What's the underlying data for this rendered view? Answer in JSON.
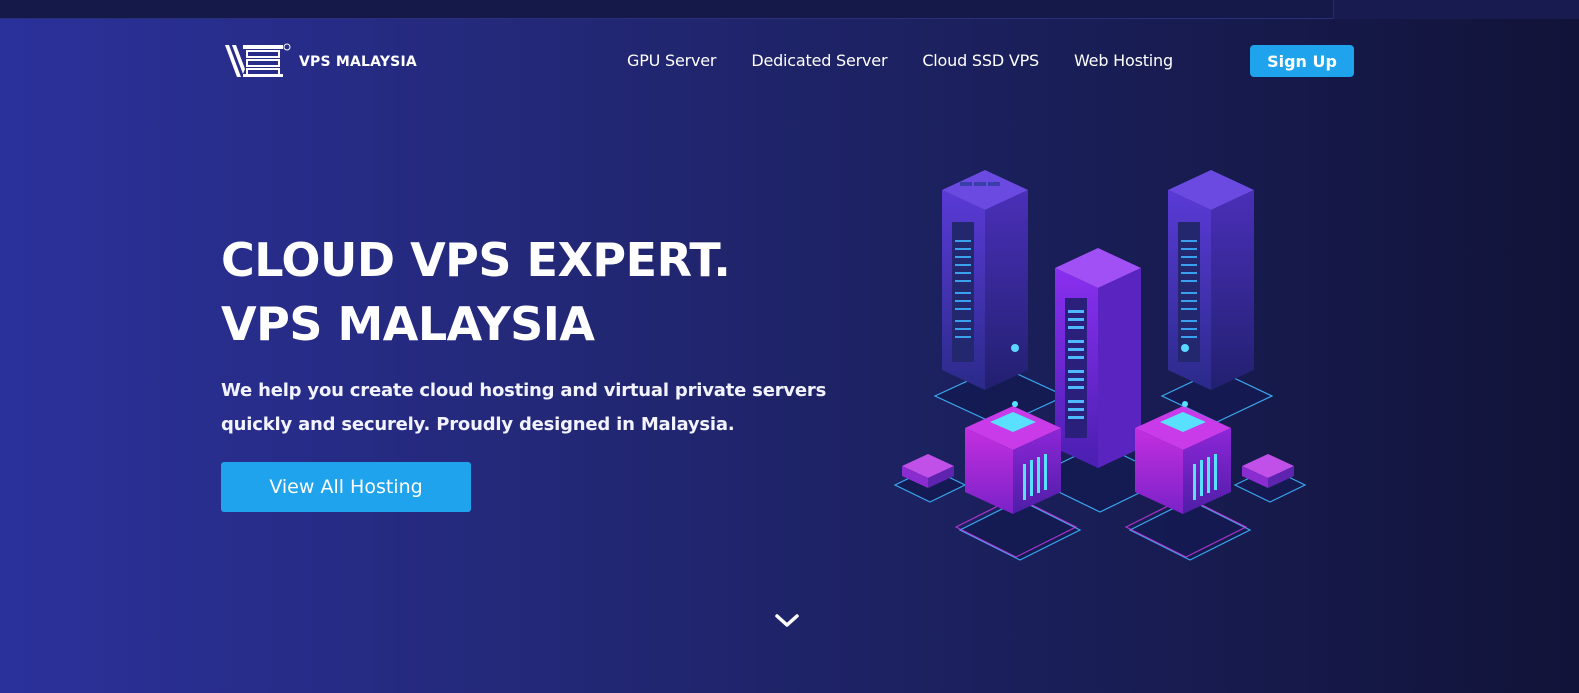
{
  "header": {
    "logo_text": "VPS MALAYSIA",
    "logo_icon": "vps-logo-mark",
    "nav": [
      {
        "label": "GPU Server"
      },
      {
        "label": "Dedicated Server"
      },
      {
        "label": "Cloud SSD VPS"
      },
      {
        "label": "Web Hosting"
      }
    ],
    "signup_label": "Sign Up"
  },
  "hero": {
    "title_line1": "CLOUD VPS EXPERT.",
    "title_line2": "VPS MALAYSIA",
    "subtitle_line1": "We help you create cloud hosting and virtual private servers",
    "subtitle_line2": "quickly and securely. Proudly designed in Malaysia.",
    "cta_label": "View All Hosting",
    "illustration": "isometric-servers-illustration",
    "scroll_icon": "chevron-down-icon"
  },
  "colors": {
    "accent": "#1fa3ec",
    "bg_left": "#2b319b",
    "bg_right": "#111338",
    "server_purple": "#7b2ff0",
    "glow_cyan": "#3fd7ff"
  }
}
